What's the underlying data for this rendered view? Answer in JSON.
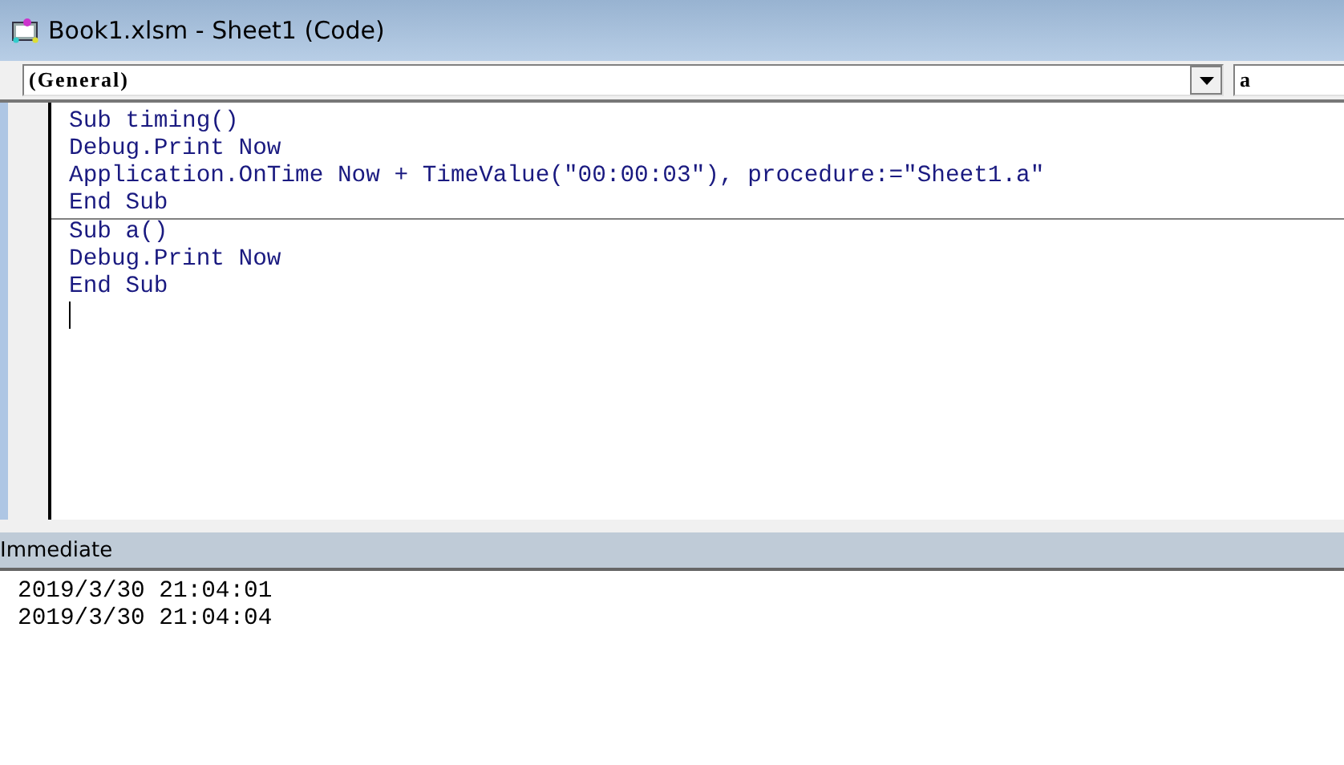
{
  "window": {
    "title": "Book1.xlsm - Sheet1 (Code)"
  },
  "object_box": {
    "value": "(General)"
  },
  "procedure_box": {
    "value": "a"
  },
  "procedures": [
    {
      "lines": [
        "Sub timing()",
        "Debug.Print Now",
        "Application.OnTime Now + TimeValue(\"00:00:03\"), procedure:=\"Sheet1.a\"",
        "End Sub"
      ]
    },
    {
      "lines": [
        "Sub a()",
        "Debug.Print Now",
        "End Sub"
      ]
    }
  ],
  "immediate": {
    "title": "Immediate",
    "lines": [
      "2019/3/30 21:04:01",
      "2019/3/30 21:04:04"
    ]
  }
}
